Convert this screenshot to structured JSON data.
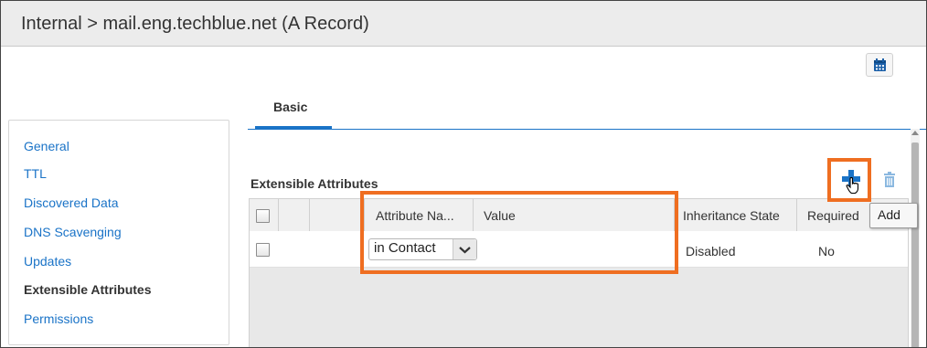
{
  "window": {
    "title": "Internal > mail.eng.techblue.net (A Record)"
  },
  "tabs": [
    {
      "label": "Basic",
      "active": true
    }
  ],
  "sidebar": {
    "items": [
      {
        "label": "General",
        "active": false
      },
      {
        "label": "TTL",
        "active": false
      },
      {
        "label": "Discovered Data",
        "active": false
      },
      {
        "label": "DNS Scavenging",
        "active": false
      },
      {
        "label": "Updates",
        "active": false
      },
      {
        "label": "Extensible Attributes",
        "active": true
      },
      {
        "label": "Permissions",
        "active": false
      }
    ]
  },
  "extensible_attributes": {
    "section_title": "Extensible Attributes",
    "toolbar": {
      "add_icon": "plus-icon",
      "delete_icon": "trash-icon",
      "add_tooltip": "Add"
    },
    "columns": [
      "Attribute Na...",
      "Value",
      "Inheritance State",
      "Required"
    ],
    "rows": [
      {
        "attribute_name": "in Contact",
        "value": "",
        "inheritance_state": "Disabled",
        "required": "No"
      }
    ]
  },
  "icons": {
    "calendar": "calendar-icon",
    "dropdown": "chevron-down-icon",
    "cursor": "hand-pointer-icon"
  },
  "colors": {
    "accent": "#1a73c7",
    "highlight": "#ef6e21"
  }
}
